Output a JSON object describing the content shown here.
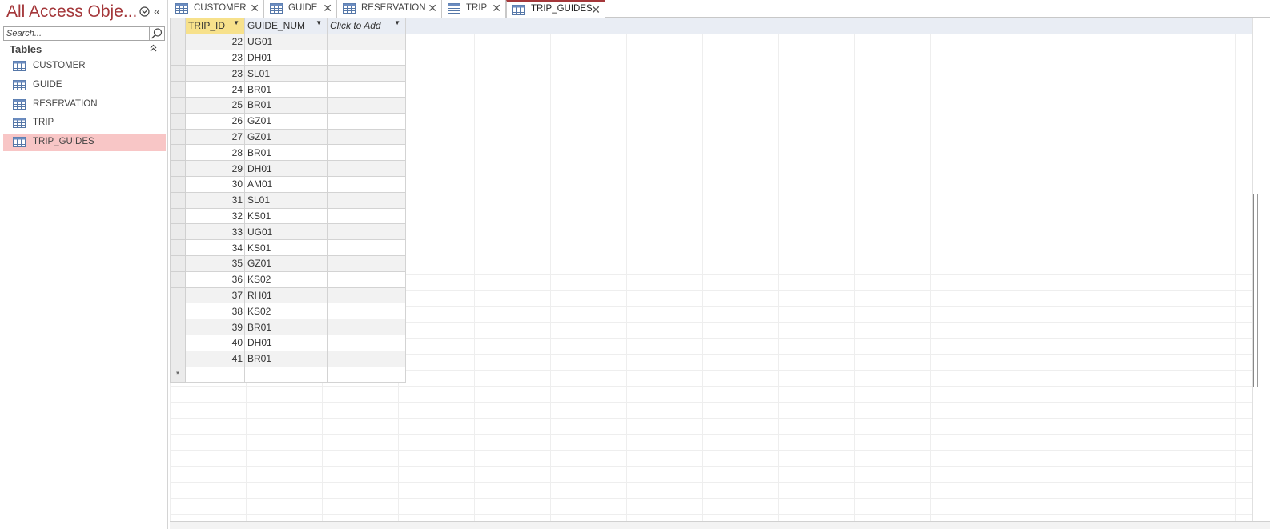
{
  "nav": {
    "title": "All Access Obje...",
    "search_placeholder": "Search...",
    "group_label": "Tables",
    "items": [
      {
        "label": "CUSTOMER",
        "selected": false
      },
      {
        "label": "GUIDE",
        "selected": false
      },
      {
        "label": "RESERVATION",
        "selected": false
      },
      {
        "label": "TRIP",
        "selected": false
      },
      {
        "label": "TRIP_GUIDES",
        "selected": true
      }
    ]
  },
  "tabs": [
    {
      "label": "CUSTOMER",
      "active": false
    },
    {
      "label": "GUIDE",
      "active": false
    },
    {
      "label": "RESERVATION",
      "active": false
    },
    {
      "label": "TRIP",
      "active": false
    },
    {
      "label": "TRIP_GUIDES",
      "active": true
    }
  ],
  "datasheet": {
    "columns": [
      "TRIP_ID",
      "GUIDE_NUM",
      "Click to Add"
    ],
    "rows": [
      {
        "trip_id": "22",
        "guide_num": "UG01"
      },
      {
        "trip_id": "23",
        "guide_num": "DH01"
      },
      {
        "trip_id": "23",
        "guide_num": "SL01"
      },
      {
        "trip_id": "24",
        "guide_num": "BR01"
      },
      {
        "trip_id": "25",
        "guide_num": "BR01"
      },
      {
        "trip_id": "26",
        "guide_num": "GZ01"
      },
      {
        "trip_id": "27",
        "guide_num": "GZ01"
      },
      {
        "trip_id": "28",
        "guide_num": "BR01"
      },
      {
        "trip_id": "29",
        "guide_num": "DH01"
      },
      {
        "trip_id": "30",
        "guide_num": "AM01"
      },
      {
        "trip_id": "31",
        "guide_num": "SL01"
      },
      {
        "trip_id": "32",
        "guide_num": "KS01"
      },
      {
        "trip_id": "33",
        "guide_num": "UG01"
      },
      {
        "trip_id": "34",
        "guide_num": "KS01"
      },
      {
        "trip_id": "35",
        "guide_num": "GZ01"
      },
      {
        "trip_id": "36",
        "guide_num": "KS02"
      },
      {
        "trip_id": "37",
        "guide_num": "RH01"
      },
      {
        "trip_id": "38",
        "guide_num": "KS02"
      },
      {
        "trip_id": "39",
        "guide_num": "BR01"
      },
      {
        "trip_id": "40",
        "guide_num": "DH01"
      },
      {
        "trip_id": "41",
        "guide_num": "BR01"
      }
    ],
    "new_record_symbol": "*"
  },
  "icons": {
    "table": "table-icon",
    "close": "close-icon",
    "search": "search-icon",
    "nav_menu": "chevron-down-circle-icon",
    "nav_collapse": "double-chevron-left-icon",
    "group_collapse": "double-chevron-up-icon",
    "sort_caret": "dropdown-caret-icon"
  },
  "colors": {
    "accent": "#a4373a",
    "selected_nav_bg": "#f8c6c6",
    "selected_column_header": "#f7e18b",
    "header_bg": "#e9edf4"
  }
}
